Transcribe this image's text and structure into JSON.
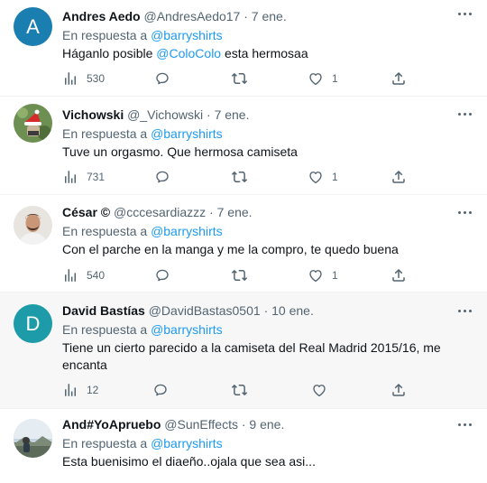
{
  "tweets": [
    {
      "name": "Andres Aedo",
      "handle": "@AndresAedo17",
      "date": "7 ene.",
      "reply_prefix": "En respuesta a",
      "reply_to": "@barryshirts",
      "text_before": "Háganlo posible ",
      "mention": "@ColoColo",
      "text_after": " esta hermosaa",
      "views": "530",
      "likes": "1",
      "avatar_letter": "A",
      "avatar_color": "#1a7fb0"
    },
    {
      "name": "Vichowski",
      "handle": "@_Vichowski",
      "date": "7 ene.",
      "reply_prefix": "En respuesta a",
      "reply_to": "@barryshirts",
      "text": "Tuve un orgasmo. Que hermosa camiseta",
      "views": "731",
      "likes": "1"
    },
    {
      "name": "César ©",
      "handle": "@cccesardiazzz",
      "date": "7 ene.",
      "reply_prefix": "En respuesta a",
      "reply_to": "@barryshirts",
      "text": "Con el parche en la manga y me la compro, te quedo buena",
      "views": "540",
      "likes": "1"
    },
    {
      "name": "David Bastías",
      "handle": "@DavidBastas0501",
      "date": "10 ene.",
      "reply_prefix": "En respuesta a",
      "reply_to": "@barryshirts",
      "text": "Tiene un cierto parecido a la camiseta del Real Madrid 2015/16, me encanta",
      "views": "12",
      "avatar_letter": "D",
      "avatar_color": "#1d9ba8"
    },
    {
      "name": "And#YoApruebo",
      "handle": "@SunEffects",
      "date": "9 ene.",
      "reply_prefix": "En respuesta a",
      "reply_to": "@barryshirts",
      "text": "Esta buenisimo el diaeño..ojala que sea asi..."
    }
  ],
  "icons": [
    "views-icon",
    "reply-icon",
    "retweet-icon",
    "like-icon",
    "share-icon",
    "more-icon"
  ],
  "colors": {
    "link": "#1d9bf0",
    "secondary": "#536471",
    "text": "#0f1419",
    "hover_bg": "#f7f7f7"
  }
}
